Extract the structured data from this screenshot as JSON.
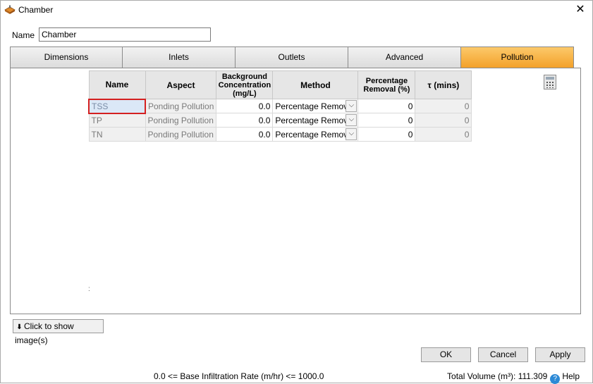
{
  "window": {
    "title": "Chamber"
  },
  "name_field": {
    "label": "Name",
    "value": "Chamber"
  },
  "tabs": [
    {
      "label": "Dimensions"
    },
    {
      "label": "Inlets"
    },
    {
      "label": "Outlets"
    },
    {
      "label": "Advanced"
    },
    {
      "label": "Pollution",
      "active": true
    }
  ],
  "grid": {
    "headers": [
      "Name",
      "Aspect",
      "Background Concentration (mg/L)",
      "Method",
      "Percentage Removal (%)",
      "τ (mins)"
    ],
    "rows": [
      {
        "name": "TSS",
        "aspect": "Ponding Pollution",
        "background": "0.0",
        "method": "Percentage Removal",
        "removal": "0",
        "tau": "0"
      },
      {
        "name": "TP",
        "aspect": "Ponding Pollution",
        "background": "0.0",
        "method": "Percentage Removal",
        "removal": "0",
        "tau": "0"
      },
      {
        "name": "TN",
        "aspect": "Ponding Pollution",
        "background": "0.0",
        "method": "Percentage Removal",
        "removal": "0",
        "tau": "0"
      }
    ]
  },
  "panel_marker": ":",
  "show_image_button": {
    "label": "Click to show image(s)",
    "icon": "double-chevron-down-icon"
  },
  "buttons": {
    "ok": "OK",
    "cancel": "Cancel",
    "apply": "Apply"
  },
  "status": {
    "infiltration": "0.0 <= Base Infiltration Rate (m/hr) <= 1000.0",
    "total_volume": "Total Volume (m³): 111.309",
    "help": "Help"
  },
  "icons": {
    "app": "chamber-app-icon",
    "close": "close-icon",
    "calculator": "calculator-icon",
    "dropdown": "chevron-down-icon",
    "help": "help-icon"
  },
  "colors": {
    "active_tab": "#f3a12a",
    "selection_border": "#d42020",
    "help_icon": "#2d8ad6"
  }
}
